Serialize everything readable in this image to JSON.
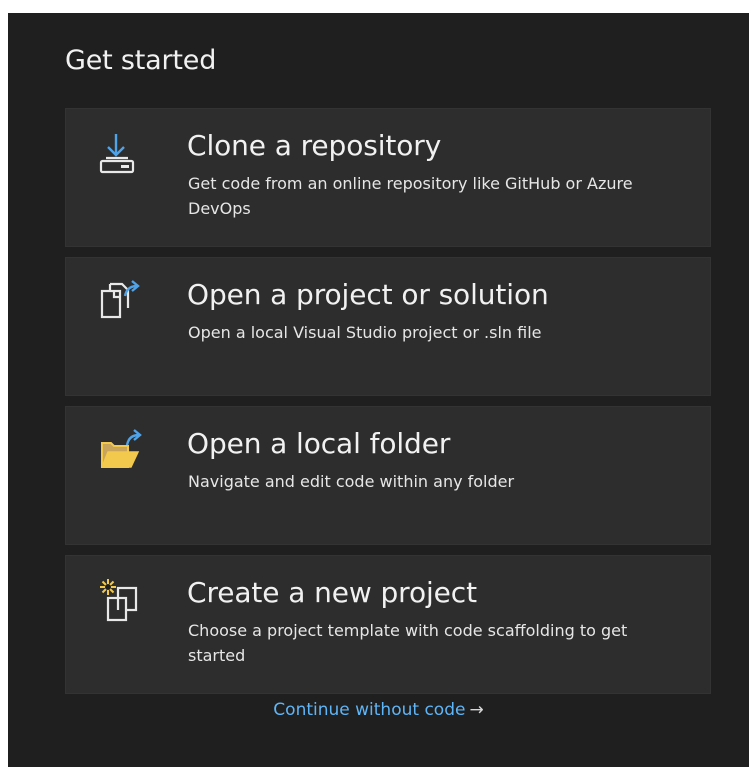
{
  "heading": "Get started",
  "cards": [
    {
      "icon": "clone-repository-icon",
      "title": "Clone a repository",
      "description": "Get code from an online repository like GitHub or Azure DevOps"
    },
    {
      "icon": "open-project-icon",
      "title": "Open a project or solution",
      "description": "Open a local Visual Studio project or .sln file"
    },
    {
      "icon": "open-folder-icon",
      "title": "Open a local folder",
      "description": "Navigate and edit code within any folder"
    },
    {
      "icon": "new-project-icon",
      "title": "Create a new project",
      "description": "Choose a project template with code scaffolding to get started"
    }
  ],
  "continue_link": {
    "label": "Continue without code",
    "arrow": "→"
  },
  "colors": {
    "background": "#1f1f1f",
    "card": "#2d2d2d",
    "text": "#f1f1f1",
    "link": "#5eb5f7",
    "icon_accent_blue": "#4fa3e8",
    "icon_accent_yellow": "#f2c94c"
  }
}
